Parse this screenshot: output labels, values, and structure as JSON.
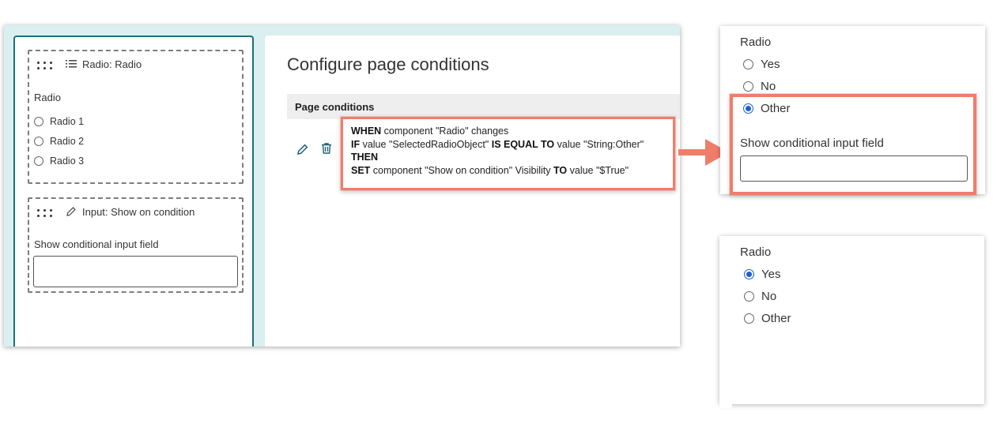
{
  "left_panel": {
    "radio_component": {
      "header": "Radio: Radio",
      "label": "Radio",
      "options": [
        "Radio 1",
        "Radio 2",
        "Radio 3"
      ]
    },
    "input_component": {
      "header": "Input: Show on condition",
      "label": "Show conditional input field"
    }
  },
  "right_panel": {
    "title": "Configure page conditions",
    "section_header": "Page conditions",
    "condition": {
      "line1": {
        "kw": "WHEN",
        "rest": " component \"Radio\" changes"
      },
      "line2": {
        "kw": "IF",
        "a": " value \"SelectedRadioObject\" ",
        "kw2": "IS EQUAL TO",
        "b": " value \"String:Other\""
      },
      "line3": {
        "kw": "THEN"
      },
      "line4": {
        "kw": "SET",
        "a": " component \"Show on condition\" Visibility ",
        "kw2": "TO",
        "b": " value \"$True\""
      }
    }
  },
  "preview_other": {
    "label": "Radio",
    "options": [
      "Yes",
      "No",
      "Other"
    ],
    "selected": "Other",
    "input_label": "Show conditional input field"
  },
  "preview_yes": {
    "label": "Radio",
    "options": [
      "Yes",
      "No",
      "Other"
    ],
    "selected": "Yes"
  },
  "colors": {
    "highlight": "#f07d6a",
    "panel_border": "#1f6f7a",
    "radio_selected": "#1a5fd6",
    "editor_background": "#d9eff0"
  }
}
